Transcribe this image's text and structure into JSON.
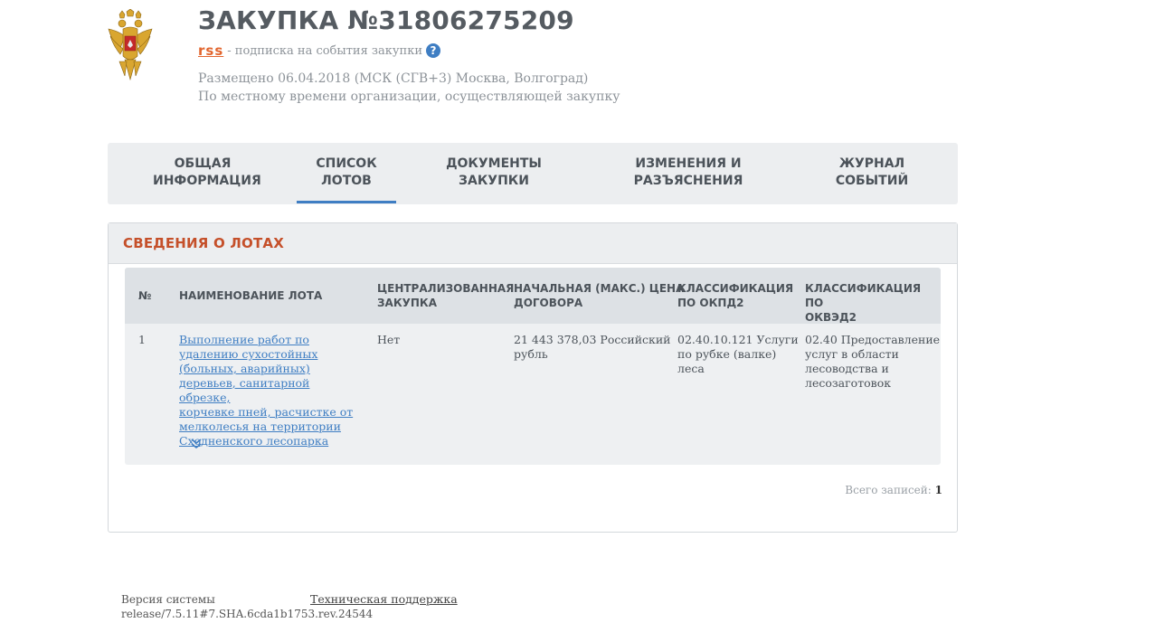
{
  "header": {
    "title": "ЗАКУПКА №31806275209",
    "rss_label": "rss",
    "rss_text": "- подписка на события закупки",
    "help_glyph": "?",
    "posted_line1": "Размещено 06.04.2018 (МСК (СГВ+3) Москва, Волгоград)",
    "posted_line2": "По местному времени организации, осуществляющей закупку"
  },
  "tabs": [
    {
      "line1": "ОБЩАЯ",
      "line2": "ИНФОРМАЦИЯ",
      "active": false
    },
    {
      "line1": "СПИСОК",
      "line2": "ЛОТОВ",
      "active": true
    },
    {
      "line1": "ДОКУМЕНТЫ",
      "line2": "ЗАКУПКИ",
      "active": false
    },
    {
      "line1": "ИЗМЕНЕНИЯ И",
      "line2": "РАЗЪЯСНЕНИЯ",
      "active": false
    },
    {
      "line1": "ЖУРНАЛ",
      "line2": "СОБЫТИЙ",
      "active": false
    }
  ],
  "panel": {
    "title": "СВЕДЕНИЯ О ЛОТАХ",
    "columns": {
      "num": "№",
      "name": "НАИМЕНОВАНИЕ ЛОТА",
      "central": [
        "ЦЕНТРАЛИЗОВАННАЯ",
        "ЗАКУПКА"
      ],
      "price": [
        "НАЧАЛЬНАЯ (МАКС.) ЦЕНА",
        "ДОГОВОРА"
      ],
      "okpd": [
        "КЛАССИФИКАЦИЯ",
        "ПО ОКПД2"
      ],
      "okved": [
        "КЛАССИФИКАЦИЯ ПО",
        "ОКВЭД2"
      ]
    },
    "rows": [
      {
        "num": "1",
        "name": [
          "Выполнение работ по",
          "удалению сухостойных",
          "(больных, аварийных)",
          "деревьев, санитарной обрезке,",
          "корчевке пней, расчистке от",
          "мелколесья на территории",
          "Сходненского лесопарка"
        ],
        "central": "Нет",
        "price": [
          "21 443 378,03 Российский",
          "рубль"
        ],
        "okpd": [
          "02.40.10.121 Услуги",
          "по рубке (валке)",
          "леса"
        ],
        "okved": [
          "02.40 Предоставление",
          "услуг в области",
          "лесоводства и",
          "лесозаготовок"
        ]
      }
    ],
    "total_label": "Всего записей:",
    "total_value": "1"
  },
  "footer": {
    "version_label": "Версия системы",
    "version_value": "release/7.5.11#7.SHA.6cda1b1753.rev.24544",
    "support_link": "Техническая поддержка"
  },
  "colors": {
    "title": "#555b61",
    "rss": "#e2662f",
    "accent": "#3f7ec3",
    "panel_title": "#c5502a",
    "tab_bg": "#eceef0"
  }
}
